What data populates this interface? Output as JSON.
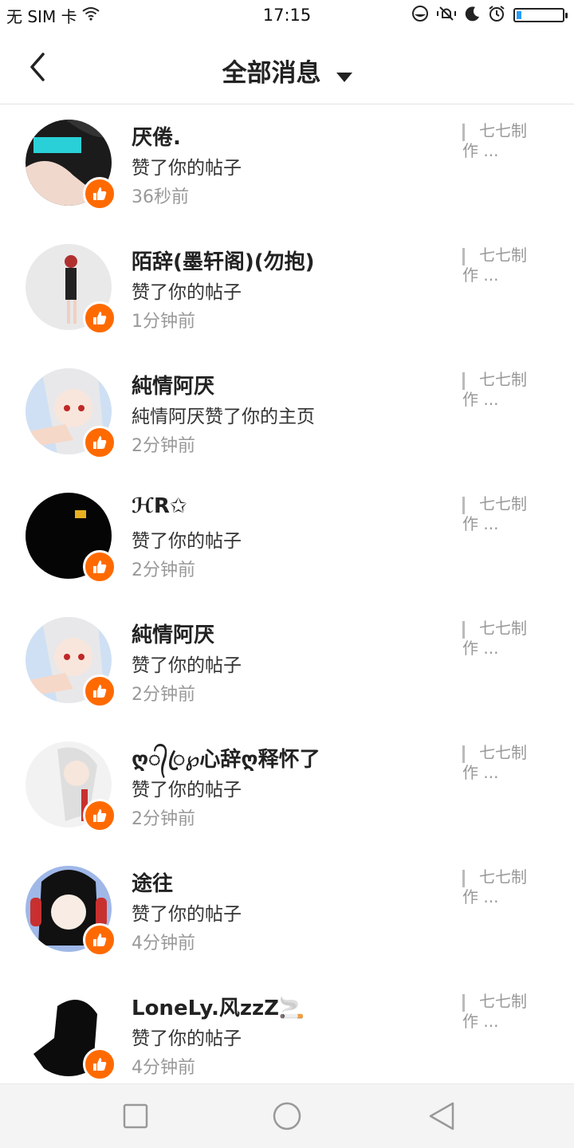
{
  "status": {
    "carrier": "无 SIM 卡",
    "time": "17:15"
  },
  "header": {
    "title": "全部消息"
  },
  "messages": [
    {
      "name": "厌倦.",
      "action": "赞了你的帖子",
      "time": "36秒前",
      "preview": "七七制作 ..."
    },
    {
      "name": "陌辞(墨轩阁)(勿抱)",
      "action": "赞了你的帖子",
      "time": "1分钟前",
      "preview": "七七制作 ..."
    },
    {
      "name": "純情阿厌",
      "action": "純情阿厌赞了你的主页",
      "time": "2分钟前",
      "preview": "七七制作 ..."
    },
    {
      "name": "ℋR✩",
      "action": "赞了你的帖子",
      "time": "2分钟前",
      "preview": "七七制作 ..."
    },
    {
      "name": "純情阿厌",
      "action": "赞了你的帖子",
      "time": "2分钟前",
      "preview": "七七制作 ..."
    },
    {
      "name": "ღ᭄ꦿ℘心辞ღ释怀了",
      "action": "赞了你的帖子",
      "time": "2分钟前",
      "preview": "七七制作 ..."
    },
    {
      "name": "途往",
      "action": "赞了你的帖子",
      "time": "4分钟前",
      "preview": "七七制作 ..."
    },
    {
      "name": "LoneLy.风zzZ🚬",
      "action": "赞了你的帖子",
      "time": "4分钟前",
      "preview": "七七制作 ..."
    }
  ],
  "colors": {
    "like_badge": "#ff6a00",
    "time_text": "#999999"
  }
}
